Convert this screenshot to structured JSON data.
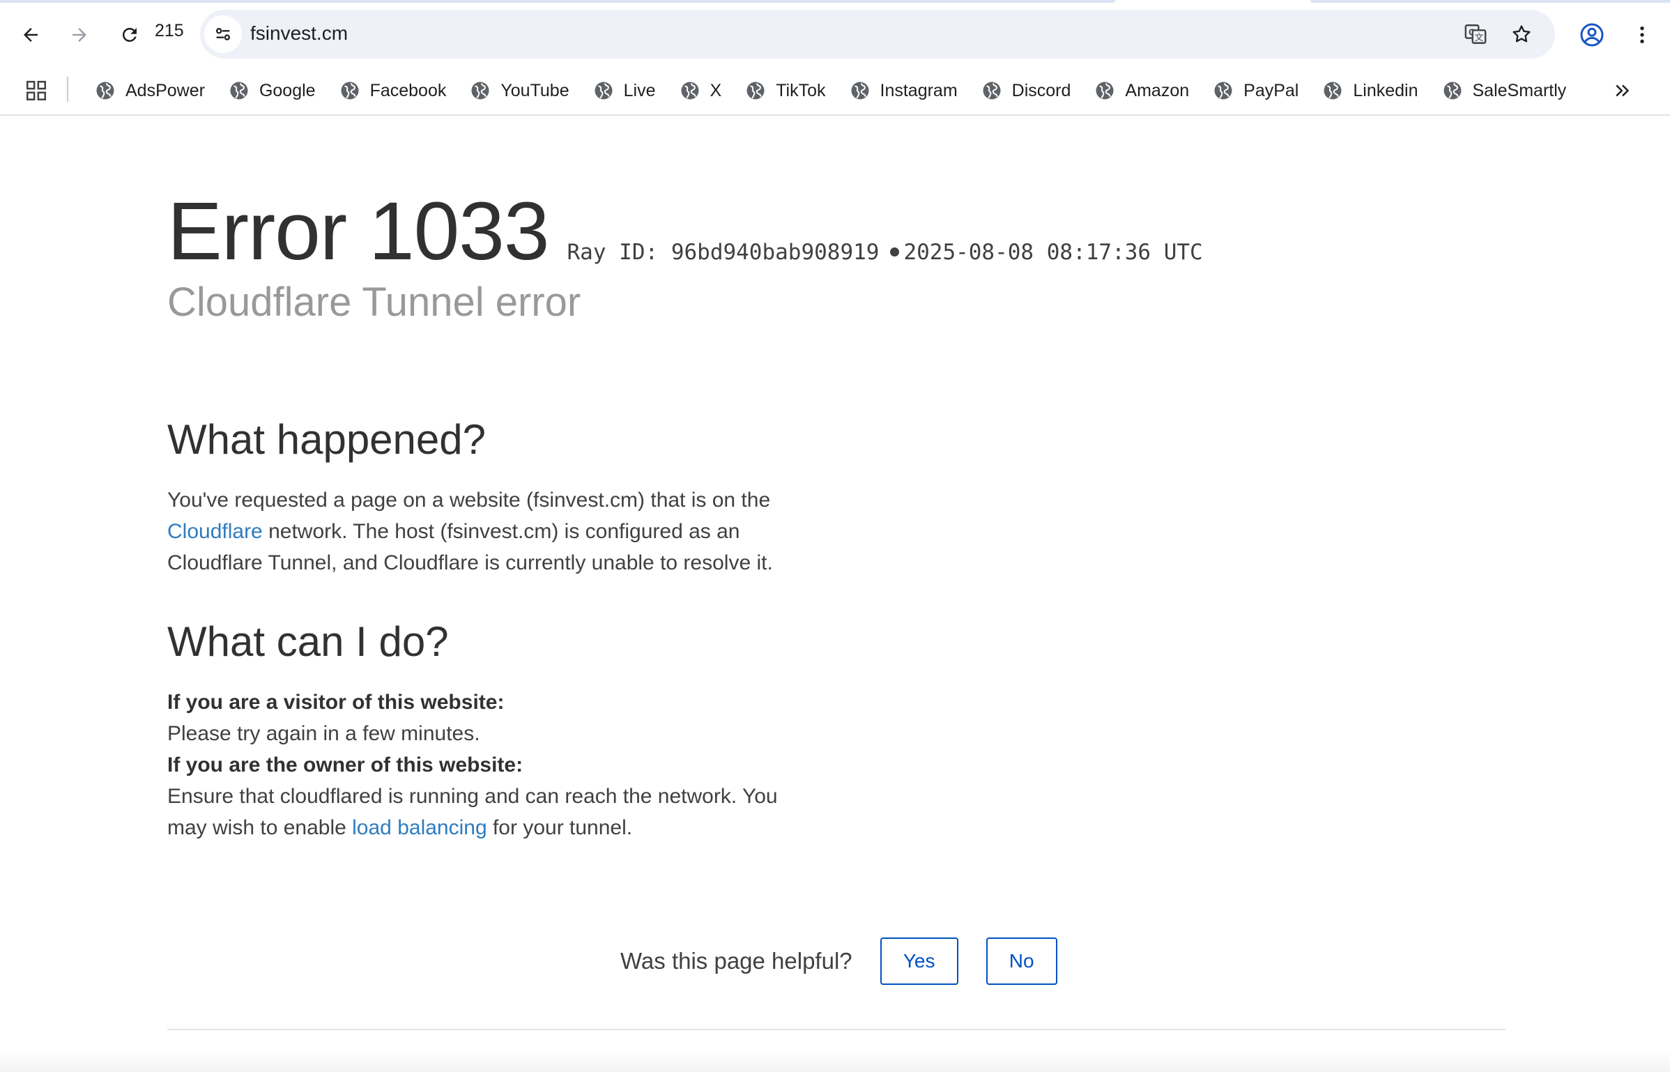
{
  "browser": {
    "tab_count": "215",
    "url": "fsinvest.cm"
  },
  "bookmarks": [
    {
      "label": "AdsPower"
    },
    {
      "label": "Google"
    },
    {
      "label": "Facebook"
    },
    {
      "label": "YouTube"
    },
    {
      "label": "Live"
    },
    {
      "label": "X"
    },
    {
      "label": "TikTok"
    },
    {
      "label": "Instagram"
    },
    {
      "label": "Discord"
    },
    {
      "label": "Amazon"
    },
    {
      "label": "PayPal"
    },
    {
      "label": "Linkedin"
    },
    {
      "label": "SaleSmartly"
    }
  ],
  "error": {
    "code": "Error 1033",
    "ray_label": "Ray ID: 96bd940bab908919",
    "timestamp": "2025-08-08 08:17:36 UTC",
    "subtitle": "Cloudflare Tunnel error"
  },
  "what_happened": {
    "heading": "What happened?",
    "text_1": "You've requested a page on a website (fsinvest.cm) that is on the",
    "link": "Cloudflare",
    "text_2": " network. The host (fsinvest.cm) is configured as an Cloudflare Tunnel, and Cloudflare is currently unable to resolve it."
  },
  "what_can_i_do": {
    "heading": "What can I do?",
    "visitor_label": "If you are a visitor of this website:",
    "visitor_text": "Please try again in a few minutes.",
    "owner_label": "If you are the owner of this website:",
    "owner_text_1": "Ensure that cloudflared is running and can reach the network. You may wish to enable ",
    "owner_link": "load balancing",
    "owner_text_2": " for your tunnel."
  },
  "feedback": {
    "question": "Was this page helpful?",
    "yes": "Yes",
    "no": "No"
  },
  "colors": {
    "link": "#2f7bbf",
    "button": "#0051c3",
    "subtitle": "#999999"
  }
}
